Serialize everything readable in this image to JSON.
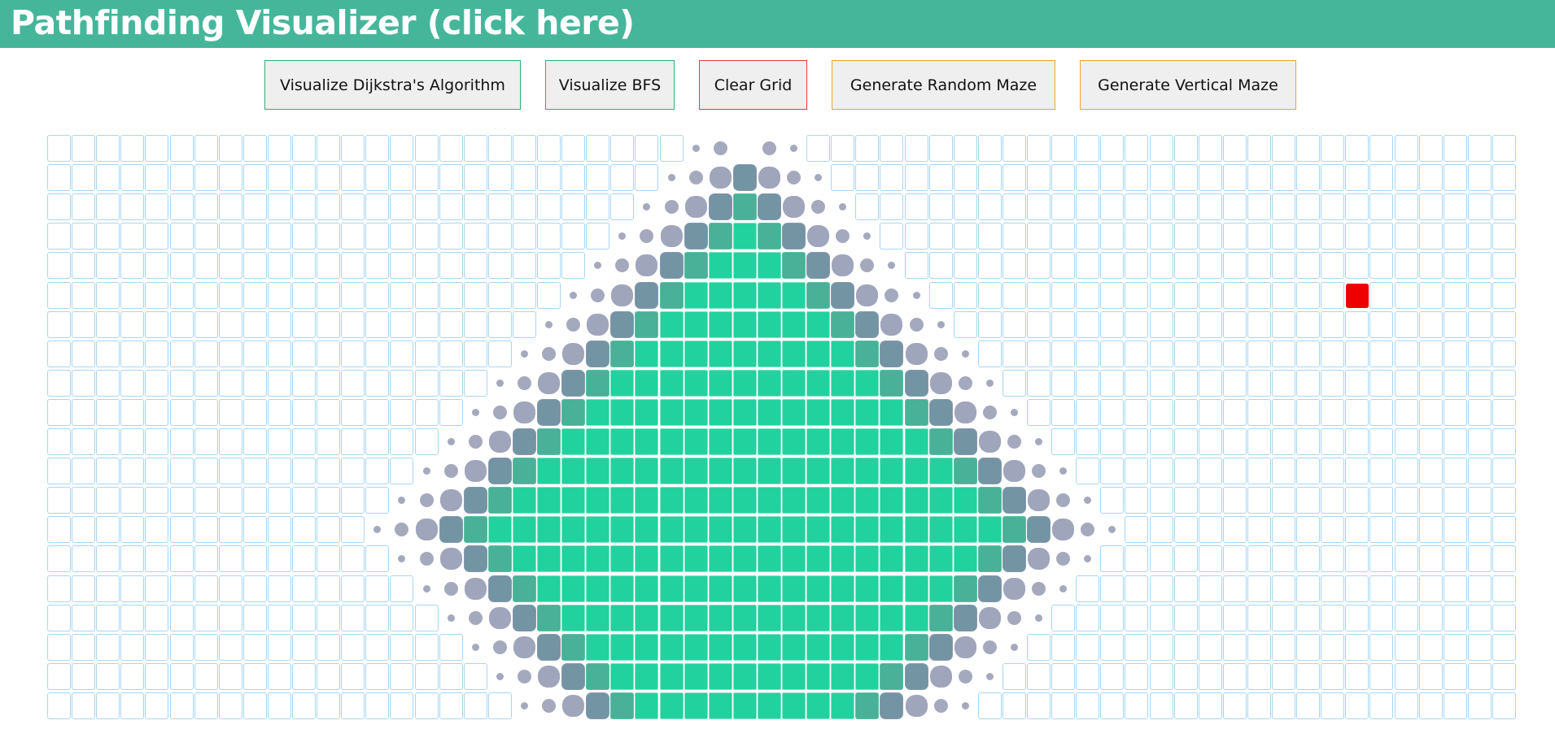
{
  "header": {
    "title": "Pathfinding Visualizer (click here)",
    "background": "#46b69b"
  },
  "toolbar": {
    "buttons": [
      {
        "label": "Visualize Dijkstra's Algorithm",
        "border": "#2eae78"
      },
      {
        "label": "Visualize BFS",
        "border": "#2eae78"
      },
      {
        "label": "Clear Grid",
        "border": "#e53b3b"
      },
      {
        "label": "Generate Random Maze",
        "border": "#f0a133"
      },
      {
        "label": "Generate Vertical Maze",
        "border": "#f0a133"
      }
    ]
  },
  "grid": {
    "rows": 20,
    "cols": 60,
    "target_node": {
      "row": 5,
      "col": 53
    },
    "visited_count": 347,
    "colors": {
      "cell_border": "#a7d6f2",
      "visited": "#21d29e",
      "frontier": "#7394a3",
      "wave": "#a5a9bd",
      "target": "#ee0000"
    }
  }
}
